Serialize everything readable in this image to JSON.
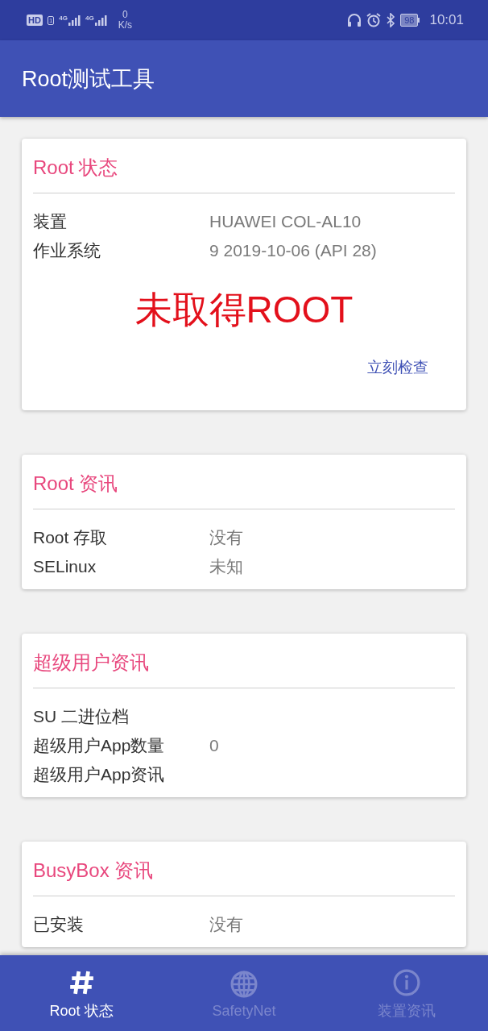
{
  "status_bar": {
    "hd_badge": "HD",
    "sim_slot": "1",
    "signals": [
      {
        "label": "4G"
      },
      {
        "label": "4G"
      }
    ],
    "speed_value": "0",
    "speed_unit": "K/s",
    "battery": "98",
    "time": "10:01"
  },
  "app_bar": {
    "title": "Root测试工具"
  },
  "cards": [
    {
      "title": "Root 状态",
      "rows": [
        {
          "label": "装置",
          "value": "HUAWEI COL-AL10"
        },
        {
          "label": "作业系统",
          "value": "9 2019-10-06 (API 28)"
        }
      ],
      "status": "未取得ROOT",
      "action": "立刻检查"
    },
    {
      "title": "Root 资讯",
      "rows": [
        {
          "label": "Root 存取",
          "value": "没有"
        },
        {
          "label": "SELinux",
          "value": "未知"
        }
      ]
    },
    {
      "title": "超级用户资讯",
      "rows": [
        {
          "label": "SU 二进位档"
        },
        {
          "label": "超级用户App数量",
          "value": "0"
        },
        {
          "label": "超级用户App资讯"
        }
      ]
    },
    {
      "title": "BusyBox 资讯",
      "rows": [
        {
          "label": "已安装",
          "value": "没有"
        }
      ]
    }
  ],
  "bottom_nav": [
    {
      "label": "Root 状态",
      "selected": true
    },
    {
      "label": "SafetyNet",
      "selected": false
    },
    {
      "label": "装置资讯",
      "selected": false
    }
  ]
}
